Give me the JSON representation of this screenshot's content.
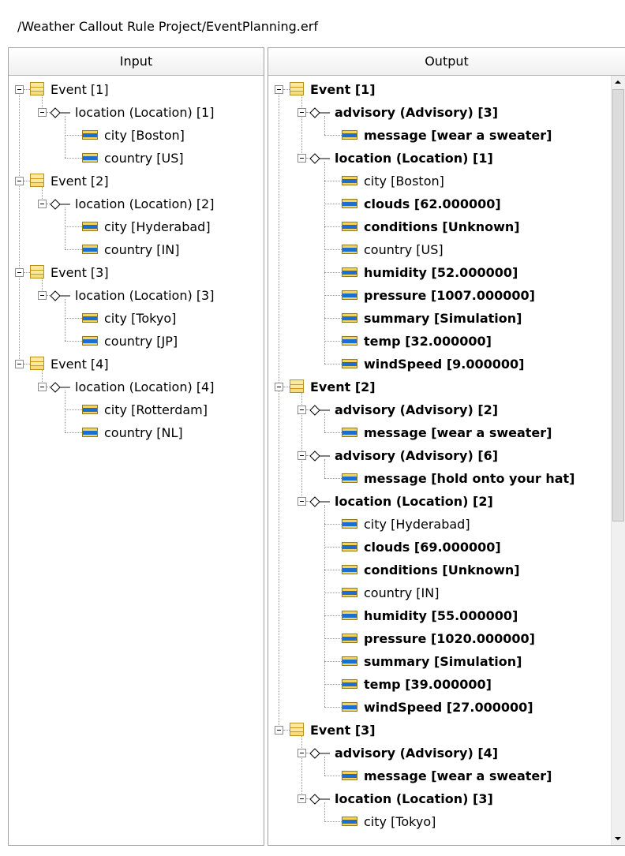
{
  "path": "/Weather Callout Rule Project/EventPlanning.erf",
  "input": {
    "header": "Input",
    "nodes": [
      {
        "type": "event",
        "depth": 0,
        "label": "Event [1]",
        "bold": false
      },
      {
        "type": "assoc",
        "depth": 1,
        "label": "location (Location) [1]",
        "bold": false
      },
      {
        "type": "prop",
        "depth": 2,
        "label": "city [Boston]",
        "bold": false
      },
      {
        "type": "prop",
        "depth": 2,
        "label": "country [US]",
        "bold": false
      },
      {
        "type": "event",
        "depth": 0,
        "label": "Event [2]",
        "bold": false
      },
      {
        "type": "assoc",
        "depth": 1,
        "label": "location (Location) [2]",
        "bold": false
      },
      {
        "type": "prop",
        "depth": 2,
        "label": "city [Hyderabad]",
        "bold": false
      },
      {
        "type": "prop",
        "depth": 2,
        "label": "country [IN]",
        "bold": false
      },
      {
        "type": "event",
        "depth": 0,
        "label": "Event [3]",
        "bold": false
      },
      {
        "type": "assoc",
        "depth": 1,
        "label": "location (Location) [3]",
        "bold": false
      },
      {
        "type": "prop",
        "depth": 2,
        "label": "city [Tokyo]",
        "bold": false
      },
      {
        "type": "prop",
        "depth": 2,
        "label": "country [JP]",
        "bold": false
      },
      {
        "type": "event",
        "depth": 0,
        "label": "Event [4]",
        "bold": false
      },
      {
        "type": "assoc",
        "depth": 1,
        "label": "location (Location) [4]",
        "bold": false
      },
      {
        "type": "prop",
        "depth": 2,
        "label": "city [Rotterdam]",
        "bold": false
      },
      {
        "type": "prop",
        "depth": 2,
        "label": "country [NL]",
        "bold": false
      }
    ]
  },
  "output": {
    "header": "Output",
    "scroll_position": 0,
    "nodes": [
      {
        "type": "event",
        "depth": 0,
        "label": "Event [1]",
        "bold": true
      },
      {
        "type": "assoc",
        "depth": 1,
        "label": "advisory (Advisory) [3]",
        "bold": true
      },
      {
        "type": "prop",
        "depth": 2,
        "label": "message [wear a sweater]",
        "bold": true
      },
      {
        "type": "assoc",
        "depth": 1,
        "label": "location (Location) [1]",
        "bold": true
      },
      {
        "type": "prop",
        "depth": 2,
        "label": "city [Boston]",
        "bold": false
      },
      {
        "type": "prop",
        "depth": 2,
        "label": "clouds [62.000000]",
        "bold": true
      },
      {
        "type": "prop",
        "depth": 2,
        "label": "conditions [Unknown]",
        "bold": true
      },
      {
        "type": "prop",
        "depth": 2,
        "label": "country [US]",
        "bold": false
      },
      {
        "type": "prop",
        "depth": 2,
        "label": "humidity [52.000000]",
        "bold": true
      },
      {
        "type": "prop",
        "depth": 2,
        "label": "pressure [1007.000000]",
        "bold": true
      },
      {
        "type": "prop",
        "depth": 2,
        "label": "summary [Simulation]",
        "bold": true
      },
      {
        "type": "prop",
        "depth": 2,
        "label": "temp [32.000000]",
        "bold": true
      },
      {
        "type": "prop",
        "depth": 2,
        "label": "windSpeed [9.000000]",
        "bold": true
      },
      {
        "type": "event",
        "depth": 0,
        "label": "Event [2]",
        "bold": true
      },
      {
        "type": "assoc",
        "depth": 1,
        "label": "advisory (Advisory) [2]",
        "bold": true
      },
      {
        "type": "prop",
        "depth": 2,
        "label": "message [wear a sweater]",
        "bold": true
      },
      {
        "type": "assoc",
        "depth": 1,
        "label": "advisory (Advisory) [6]",
        "bold": true
      },
      {
        "type": "prop",
        "depth": 2,
        "label": "message [hold onto your hat]",
        "bold": true
      },
      {
        "type": "assoc",
        "depth": 1,
        "label": "location (Location) [2]",
        "bold": true
      },
      {
        "type": "prop",
        "depth": 2,
        "label": "city [Hyderabad]",
        "bold": false
      },
      {
        "type": "prop",
        "depth": 2,
        "label": "clouds [69.000000]",
        "bold": true
      },
      {
        "type": "prop",
        "depth": 2,
        "label": "conditions [Unknown]",
        "bold": true
      },
      {
        "type": "prop",
        "depth": 2,
        "label": "country [IN]",
        "bold": false
      },
      {
        "type": "prop",
        "depth": 2,
        "label": "humidity [55.000000]",
        "bold": true
      },
      {
        "type": "prop",
        "depth": 2,
        "label": "pressure [1020.000000]",
        "bold": true
      },
      {
        "type": "prop",
        "depth": 2,
        "label": "summary [Simulation]",
        "bold": true
      },
      {
        "type": "prop",
        "depth": 2,
        "label": "temp [39.000000]",
        "bold": true
      },
      {
        "type": "prop",
        "depth": 2,
        "label": "windSpeed [27.000000]",
        "bold": true
      },
      {
        "type": "event",
        "depth": 0,
        "label": "Event [3]",
        "bold": true
      },
      {
        "type": "assoc",
        "depth": 1,
        "label": "advisory (Advisory) [4]",
        "bold": true
      },
      {
        "type": "prop",
        "depth": 2,
        "label": "message [wear a sweater]",
        "bold": true
      },
      {
        "type": "assoc",
        "depth": 1,
        "label": "location (Location) [3]",
        "bold": true
      },
      {
        "type": "prop",
        "depth": 2,
        "label": "city [Tokyo]",
        "bold": false
      }
    ]
  }
}
